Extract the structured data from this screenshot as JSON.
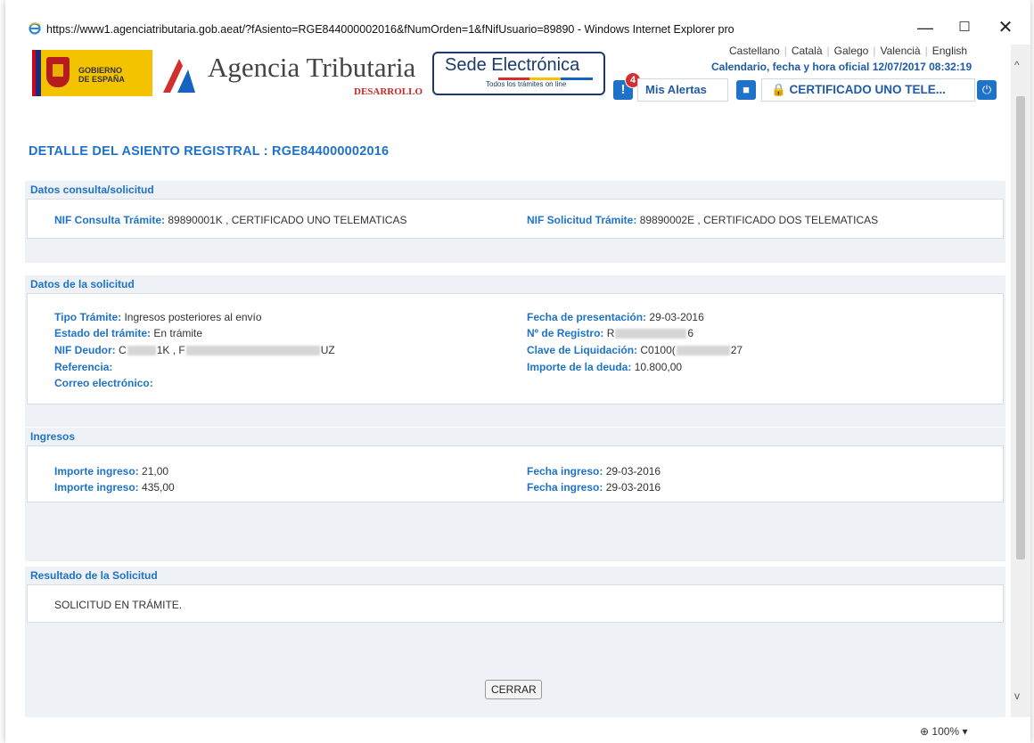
{
  "window": {
    "title": "https://www1.agenciatributaria.gob.aeat/?fAsiento=RGE844000002016&fNumOrden=1&fNifUsuario=89890 - Windows Internet Explorer pro",
    "minimize": "—",
    "maximize": "☐",
    "close": "✕"
  },
  "header": {
    "gob_line1": "GOBIERNO",
    "gob_line2": "DE ESPAÑA",
    "brand": "Agencia Tributaria",
    "brand_env": "DESARROLLO",
    "sede_word1": "Sede",
    "sede_word2": "Electrónica",
    "sede_tagline": "Todos los trámites on line",
    "languages": [
      "Castellano",
      "Català",
      "Galego",
      "Valencià",
      "English"
    ],
    "date_line": "Calendario, fecha y hora oficial 12/07/2017 08:32:19",
    "alerts_count": "4",
    "alerts_label": "Mis Alertas",
    "user_label": "🔒 CERTIFICADO UNO TELE..."
  },
  "page_title": "DETALLE DEL ASIENTO REGISTRAL : RGE844000002016",
  "sections": {
    "consulta": {
      "title": "Datos consulta/solicitud",
      "nif_consulta_label": "NIF Consulta Trámite:",
      "nif_consulta_value": "89890001K , CERTIFICADO UNO TELEMATICAS",
      "nif_solicitud_label": "NIF Solicitud Trámite:",
      "nif_solicitud_value": "89890002E , CERTIFICADO DOS TELEMATICAS"
    },
    "solicitud": {
      "title": "Datos de la solicitud",
      "tipo_label": "Tipo Trámite:",
      "tipo_value": "Ingresos posteriores al envío",
      "estado_label": "Estado del trámite:",
      "estado_value": "En trámite",
      "nif_deudor_label": "NIF Deudor:",
      "nif_deudor_a": "C",
      "nif_deudor_b": "1K , F",
      "nif_deudor_c": "UZ",
      "referencia_label": "Referencia:",
      "correo_label": "Correo electrónico:",
      "fecha_label": "Fecha de presentación:",
      "fecha_value": "29-03-2016",
      "registro_label": "Nº de Registro:",
      "registro_a": "R",
      "registro_b": "6",
      "clave_label": "Clave de Liquidación:",
      "clave_a": "C0100(",
      "clave_b": "27",
      "importe_label": "Importe de la deuda:",
      "importe_value": "10.800,00"
    },
    "ingresos": {
      "title": "Ingresos",
      "rows": [
        {
          "importe_label": "Importe ingreso:",
          "importe_value": "21,00",
          "fecha_label": "Fecha ingreso:",
          "fecha_value": "29-03-2016"
        },
        {
          "importe_label": "Importe ingreso:",
          "importe_value": "435,00",
          "fecha_label": "Fecha ingreso:",
          "fecha_value": "29-03-2016"
        }
      ]
    },
    "resultado": {
      "title": "Resultado de la Solicitud",
      "text": "SOLICITUD EN TRÁMITE."
    }
  },
  "close_button": "CERRAR",
  "status": {
    "zoom": "100%"
  },
  "colors": {
    "accent": "#1e73c8",
    "section_bg": "#eef1f5"
  }
}
